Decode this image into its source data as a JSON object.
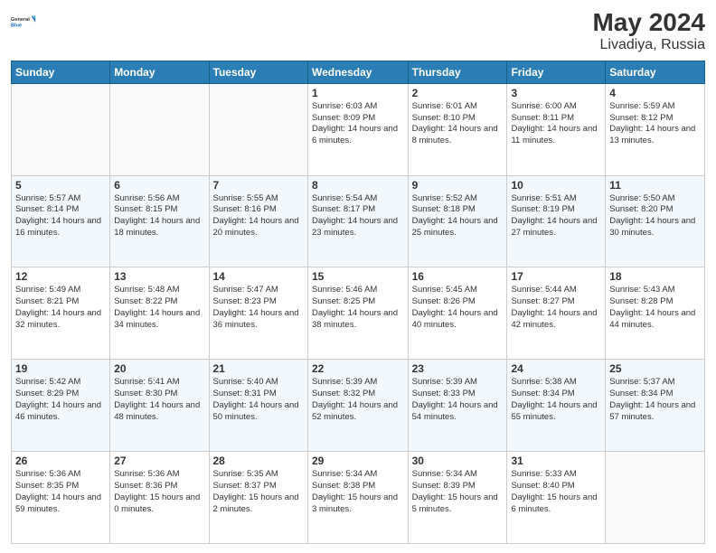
{
  "header": {
    "logo_line1": "General",
    "logo_line2": "Blue",
    "month_year": "May 2024",
    "location": "Livadiya, Russia"
  },
  "weekdays": [
    "Sunday",
    "Monday",
    "Tuesday",
    "Wednesday",
    "Thursday",
    "Friday",
    "Saturday"
  ],
  "weeks": [
    [
      {
        "day": "",
        "sunrise": "",
        "sunset": "",
        "daylight": ""
      },
      {
        "day": "",
        "sunrise": "",
        "sunset": "",
        "daylight": ""
      },
      {
        "day": "",
        "sunrise": "",
        "sunset": "",
        "daylight": ""
      },
      {
        "day": "1",
        "sunrise": "Sunrise: 6:03 AM",
        "sunset": "Sunset: 8:09 PM",
        "daylight": "Daylight: 14 hours and 6 minutes."
      },
      {
        "day": "2",
        "sunrise": "Sunrise: 6:01 AM",
        "sunset": "Sunset: 8:10 PM",
        "daylight": "Daylight: 14 hours and 8 minutes."
      },
      {
        "day": "3",
        "sunrise": "Sunrise: 6:00 AM",
        "sunset": "Sunset: 8:11 PM",
        "daylight": "Daylight: 14 hours and 11 minutes."
      },
      {
        "day": "4",
        "sunrise": "Sunrise: 5:59 AM",
        "sunset": "Sunset: 8:12 PM",
        "daylight": "Daylight: 14 hours and 13 minutes."
      }
    ],
    [
      {
        "day": "5",
        "sunrise": "Sunrise: 5:57 AM",
        "sunset": "Sunset: 8:14 PM",
        "daylight": "Daylight: 14 hours and 16 minutes."
      },
      {
        "day": "6",
        "sunrise": "Sunrise: 5:56 AM",
        "sunset": "Sunset: 8:15 PM",
        "daylight": "Daylight: 14 hours and 18 minutes."
      },
      {
        "day": "7",
        "sunrise": "Sunrise: 5:55 AM",
        "sunset": "Sunset: 8:16 PM",
        "daylight": "Daylight: 14 hours and 20 minutes."
      },
      {
        "day": "8",
        "sunrise": "Sunrise: 5:54 AM",
        "sunset": "Sunset: 8:17 PM",
        "daylight": "Daylight: 14 hours and 23 minutes."
      },
      {
        "day": "9",
        "sunrise": "Sunrise: 5:52 AM",
        "sunset": "Sunset: 8:18 PM",
        "daylight": "Daylight: 14 hours and 25 minutes."
      },
      {
        "day": "10",
        "sunrise": "Sunrise: 5:51 AM",
        "sunset": "Sunset: 8:19 PM",
        "daylight": "Daylight: 14 hours and 27 minutes."
      },
      {
        "day": "11",
        "sunrise": "Sunrise: 5:50 AM",
        "sunset": "Sunset: 8:20 PM",
        "daylight": "Daylight: 14 hours and 30 minutes."
      }
    ],
    [
      {
        "day": "12",
        "sunrise": "Sunrise: 5:49 AM",
        "sunset": "Sunset: 8:21 PM",
        "daylight": "Daylight: 14 hours and 32 minutes."
      },
      {
        "day": "13",
        "sunrise": "Sunrise: 5:48 AM",
        "sunset": "Sunset: 8:22 PM",
        "daylight": "Daylight: 14 hours and 34 minutes."
      },
      {
        "day": "14",
        "sunrise": "Sunrise: 5:47 AM",
        "sunset": "Sunset: 8:23 PM",
        "daylight": "Daylight: 14 hours and 36 minutes."
      },
      {
        "day": "15",
        "sunrise": "Sunrise: 5:46 AM",
        "sunset": "Sunset: 8:25 PM",
        "daylight": "Daylight: 14 hours and 38 minutes."
      },
      {
        "day": "16",
        "sunrise": "Sunrise: 5:45 AM",
        "sunset": "Sunset: 8:26 PM",
        "daylight": "Daylight: 14 hours and 40 minutes."
      },
      {
        "day": "17",
        "sunrise": "Sunrise: 5:44 AM",
        "sunset": "Sunset: 8:27 PM",
        "daylight": "Daylight: 14 hours and 42 minutes."
      },
      {
        "day": "18",
        "sunrise": "Sunrise: 5:43 AM",
        "sunset": "Sunset: 8:28 PM",
        "daylight": "Daylight: 14 hours and 44 minutes."
      }
    ],
    [
      {
        "day": "19",
        "sunrise": "Sunrise: 5:42 AM",
        "sunset": "Sunset: 8:29 PM",
        "daylight": "Daylight: 14 hours and 46 minutes."
      },
      {
        "day": "20",
        "sunrise": "Sunrise: 5:41 AM",
        "sunset": "Sunset: 8:30 PM",
        "daylight": "Daylight: 14 hours and 48 minutes."
      },
      {
        "day": "21",
        "sunrise": "Sunrise: 5:40 AM",
        "sunset": "Sunset: 8:31 PM",
        "daylight": "Daylight: 14 hours and 50 minutes."
      },
      {
        "day": "22",
        "sunrise": "Sunrise: 5:39 AM",
        "sunset": "Sunset: 8:32 PM",
        "daylight": "Daylight: 14 hours and 52 minutes."
      },
      {
        "day": "23",
        "sunrise": "Sunrise: 5:39 AM",
        "sunset": "Sunset: 8:33 PM",
        "daylight": "Daylight: 14 hours and 54 minutes."
      },
      {
        "day": "24",
        "sunrise": "Sunrise: 5:38 AM",
        "sunset": "Sunset: 8:34 PM",
        "daylight": "Daylight: 14 hours and 55 minutes."
      },
      {
        "day": "25",
        "sunrise": "Sunrise: 5:37 AM",
        "sunset": "Sunset: 8:34 PM",
        "daylight": "Daylight: 14 hours and 57 minutes."
      }
    ],
    [
      {
        "day": "26",
        "sunrise": "Sunrise: 5:36 AM",
        "sunset": "Sunset: 8:35 PM",
        "daylight": "Daylight: 14 hours and 59 minutes."
      },
      {
        "day": "27",
        "sunrise": "Sunrise: 5:36 AM",
        "sunset": "Sunset: 8:36 PM",
        "daylight": "Daylight: 15 hours and 0 minutes."
      },
      {
        "day": "28",
        "sunrise": "Sunrise: 5:35 AM",
        "sunset": "Sunset: 8:37 PM",
        "daylight": "Daylight: 15 hours and 2 minutes."
      },
      {
        "day": "29",
        "sunrise": "Sunrise: 5:34 AM",
        "sunset": "Sunset: 8:38 PM",
        "daylight": "Daylight: 15 hours and 3 minutes."
      },
      {
        "day": "30",
        "sunrise": "Sunrise: 5:34 AM",
        "sunset": "Sunset: 8:39 PM",
        "daylight": "Daylight: 15 hours and 5 minutes."
      },
      {
        "day": "31",
        "sunrise": "Sunrise: 5:33 AM",
        "sunset": "Sunset: 8:40 PM",
        "daylight": "Daylight: 15 hours and 6 minutes."
      },
      {
        "day": "",
        "sunrise": "",
        "sunset": "",
        "daylight": ""
      }
    ]
  ]
}
